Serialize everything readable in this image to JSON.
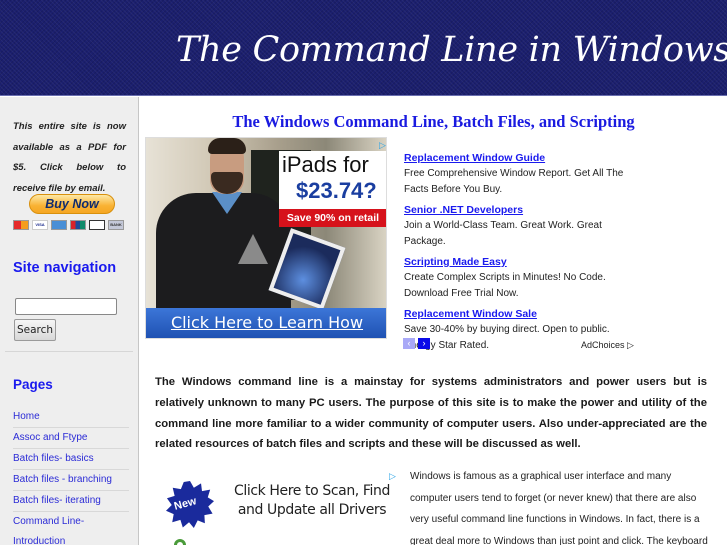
{
  "header": {
    "site_title": "The Command Line in Windows",
    "background_color": "#1b1f6e"
  },
  "sidebar": {
    "pdf_note": "This entire site is now available as a PDF for $5. Click below to receive file by email.",
    "buy_now_label": "Buy Now",
    "payment_cards": [
      "MasterCard",
      "VISA",
      "AMEX",
      "UnionPay",
      "Discover",
      "BANK"
    ],
    "site_nav_heading": "Site navigation",
    "search": {
      "value": "",
      "placeholder": "",
      "button_label": "Search"
    },
    "pages_heading": "Pages",
    "pages": [
      {
        "label": "Home"
      },
      {
        "label": "Assoc and Ftype"
      },
      {
        "label": "Batch files- basics"
      },
      {
        "label": "Batch files - branching"
      },
      {
        "label": "Batch files- iterating"
      },
      {
        "label": "Command Line-"
      },
      {
        "label": "Introduction"
      }
    ]
  },
  "main": {
    "heading": "The Windows Command Line, Batch Files, and Scripting",
    "image_ad": {
      "line1": "iPads for",
      "price": "$23.74?",
      "save": "Save 90% on retail",
      "cta": "Click Here to Learn How",
      "adchoice_icon": "▷"
    },
    "text_ads": [
      {
        "title": "Replacement Window Guide",
        "body": "Free Comprehensive Window Report. Get All The Facts Before You Buy."
      },
      {
        "title": "Senior .NET Developers",
        "body": "Join a World-Class Team. Great Work. Great Package."
      },
      {
        "title": "Scripting Made Easy",
        "body": "Create Complex Scripts in Minutes! No Code. Download Free Trial Now."
      },
      {
        "title": "Replacement Window Sale",
        "body": "Save 30-40% by buying direct. Open to public. Energy Star Rated."
      }
    ],
    "ad_nav": {
      "prev": "‹",
      "next": "›"
    },
    "adchoices_label": "AdChoices ▷",
    "intro_paragraph": "The Windows command line is a mainstay for systems administrators and power users but is relatively unknown to many PC users. The purpose of this site is to make the power and utility of the command line more familiar to a wider community of computer users. Also under-appreciated are the related resources of batch files and scripts and these will be discussed as well.",
    "driver_ad": {
      "badge": "New",
      "text": "Click Here to Scan, Find and Update all Drivers",
      "adchoice_icon": "▷"
    },
    "second_paragraph": "Windows is famous as a graphical user interface and many computer users tend to forget (or never knew) that there are also very useful command line functions in Windows. In fact, there is a great deal more to Windows than just point and click. The keyboard"
  }
}
